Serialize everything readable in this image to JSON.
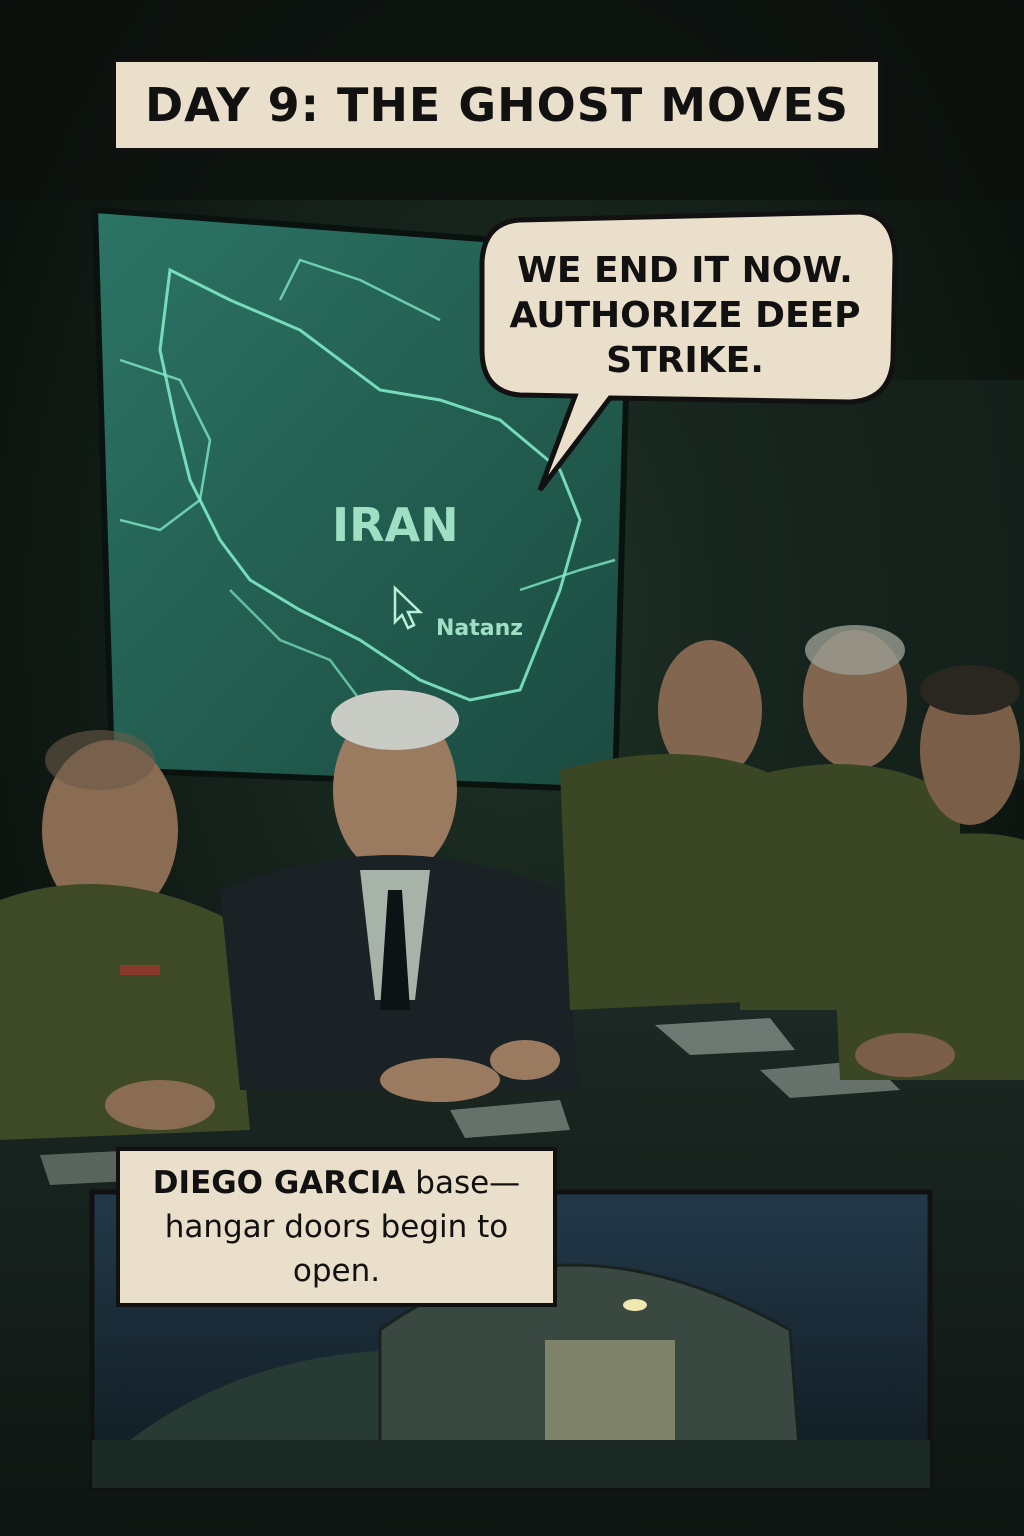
{
  "panel_top": {
    "title_caption": "DAY 9: THE GHOST MOVES",
    "speech_bubble": "WE END IT NOW.\nAUTHORIZE DEEP\nSTRIKE.",
    "map": {
      "country_label": "IRAN",
      "site_label": "Natanz",
      "cursor_icon": "pointer-arrow-icon"
    }
  },
  "panel_bottom": {
    "caption_bold": "DIEGO GARCIA",
    "caption_rest": " base—\nhangar doors begin to\nopen."
  },
  "colors": {
    "caption_bg": "#eadfca",
    "map_glow": "#6fe0b8",
    "room_dark": "#0f1a14",
    "uniform_olive": "#3e4a26"
  }
}
